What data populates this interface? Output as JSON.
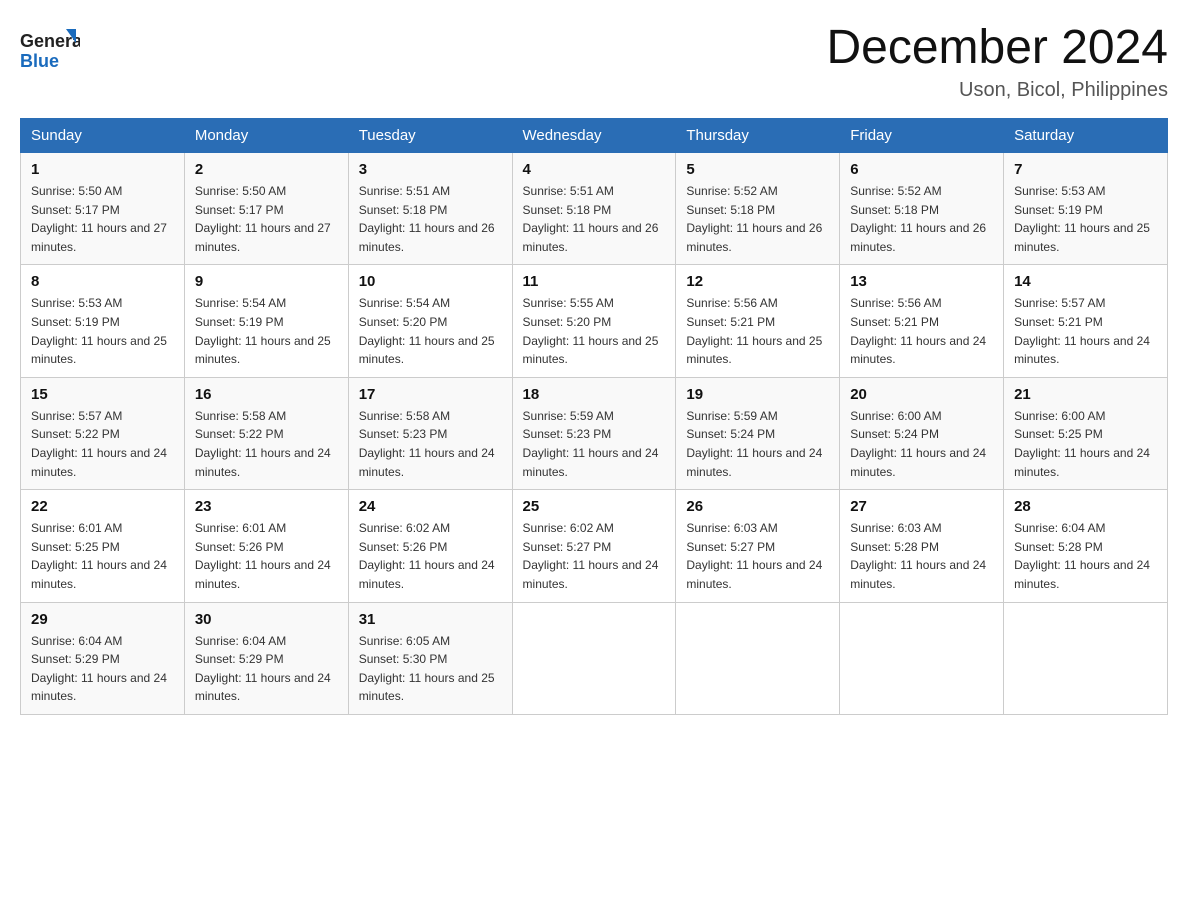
{
  "header": {
    "logo_general": "General",
    "logo_blue": "Blue",
    "month_title": "December 2024",
    "subtitle": "Uson, Bicol, Philippines"
  },
  "days_of_week": [
    "Sunday",
    "Monday",
    "Tuesday",
    "Wednesday",
    "Thursday",
    "Friday",
    "Saturday"
  ],
  "weeks": [
    [
      {
        "day": "1",
        "sunrise": "5:50 AM",
        "sunset": "5:17 PM",
        "daylight": "11 hours and 27 minutes."
      },
      {
        "day": "2",
        "sunrise": "5:50 AM",
        "sunset": "5:17 PM",
        "daylight": "11 hours and 27 minutes."
      },
      {
        "day": "3",
        "sunrise": "5:51 AM",
        "sunset": "5:18 PM",
        "daylight": "11 hours and 26 minutes."
      },
      {
        "day": "4",
        "sunrise": "5:51 AM",
        "sunset": "5:18 PM",
        "daylight": "11 hours and 26 minutes."
      },
      {
        "day": "5",
        "sunrise": "5:52 AM",
        "sunset": "5:18 PM",
        "daylight": "11 hours and 26 minutes."
      },
      {
        "day": "6",
        "sunrise": "5:52 AM",
        "sunset": "5:18 PM",
        "daylight": "11 hours and 26 minutes."
      },
      {
        "day": "7",
        "sunrise": "5:53 AM",
        "sunset": "5:19 PM",
        "daylight": "11 hours and 25 minutes."
      }
    ],
    [
      {
        "day": "8",
        "sunrise": "5:53 AM",
        "sunset": "5:19 PM",
        "daylight": "11 hours and 25 minutes."
      },
      {
        "day": "9",
        "sunrise": "5:54 AM",
        "sunset": "5:19 PM",
        "daylight": "11 hours and 25 minutes."
      },
      {
        "day": "10",
        "sunrise": "5:54 AM",
        "sunset": "5:20 PM",
        "daylight": "11 hours and 25 minutes."
      },
      {
        "day": "11",
        "sunrise": "5:55 AM",
        "sunset": "5:20 PM",
        "daylight": "11 hours and 25 minutes."
      },
      {
        "day": "12",
        "sunrise": "5:56 AM",
        "sunset": "5:21 PM",
        "daylight": "11 hours and 25 minutes."
      },
      {
        "day": "13",
        "sunrise": "5:56 AM",
        "sunset": "5:21 PM",
        "daylight": "11 hours and 24 minutes."
      },
      {
        "day": "14",
        "sunrise": "5:57 AM",
        "sunset": "5:21 PM",
        "daylight": "11 hours and 24 minutes."
      }
    ],
    [
      {
        "day": "15",
        "sunrise": "5:57 AM",
        "sunset": "5:22 PM",
        "daylight": "11 hours and 24 minutes."
      },
      {
        "day": "16",
        "sunrise": "5:58 AM",
        "sunset": "5:22 PM",
        "daylight": "11 hours and 24 minutes."
      },
      {
        "day": "17",
        "sunrise": "5:58 AM",
        "sunset": "5:23 PM",
        "daylight": "11 hours and 24 minutes."
      },
      {
        "day": "18",
        "sunrise": "5:59 AM",
        "sunset": "5:23 PM",
        "daylight": "11 hours and 24 minutes."
      },
      {
        "day": "19",
        "sunrise": "5:59 AM",
        "sunset": "5:24 PM",
        "daylight": "11 hours and 24 minutes."
      },
      {
        "day": "20",
        "sunrise": "6:00 AM",
        "sunset": "5:24 PM",
        "daylight": "11 hours and 24 minutes."
      },
      {
        "day": "21",
        "sunrise": "6:00 AM",
        "sunset": "5:25 PM",
        "daylight": "11 hours and 24 minutes."
      }
    ],
    [
      {
        "day": "22",
        "sunrise": "6:01 AM",
        "sunset": "5:25 PM",
        "daylight": "11 hours and 24 minutes."
      },
      {
        "day": "23",
        "sunrise": "6:01 AM",
        "sunset": "5:26 PM",
        "daylight": "11 hours and 24 minutes."
      },
      {
        "day": "24",
        "sunrise": "6:02 AM",
        "sunset": "5:26 PM",
        "daylight": "11 hours and 24 minutes."
      },
      {
        "day": "25",
        "sunrise": "6:02 AM",
        "sunset": "5:27 PM",
        "daylight": "11 hours and 24 minutes."
      },
      {
        "day": "26",
        "sunrise": "6:03 AM",
        "sunset": "5:27 PM",
        "daylight": "11 hours and 24 minutes."
      },
      {
        "day": "27",
        "sunrise": "6:03 AM",
        "sunset": "5:28 PM",
        "daylight": "11 hours and 24 minutes."
      },
      {
        "day": "28",
        "sunrise": "6:04 AM",
        "sunset": "5:28 PM",
        "daylight": "11 hours and 24 minutes."
      }
    ],
    [
      {
        "day": "29",
        "sunrise": "6:04 AM",
        "sunset": "5:29 PM",
        "daylight": "11 hours and 24 minutes."
      },
      {
        "day": "30",
        "sunrise": "6:04 AM",
        "sunset": "5:29 PM",
        "daylight": "11 hours and 24 minutes."
      },
      {
        "day": "31",
        "sunrise": "6:05 AM",
        "sunset": "5:30 PM",
        "daylight": "11 hours and 25 minutes."
      },
      null,
      null,
      null,
      null
    ]
  ],
  "labels": {
    "sunrise": "Sunrise:",
    "sunset": "Sunset:",
    "daylight": "Daylight:"
  }
}
